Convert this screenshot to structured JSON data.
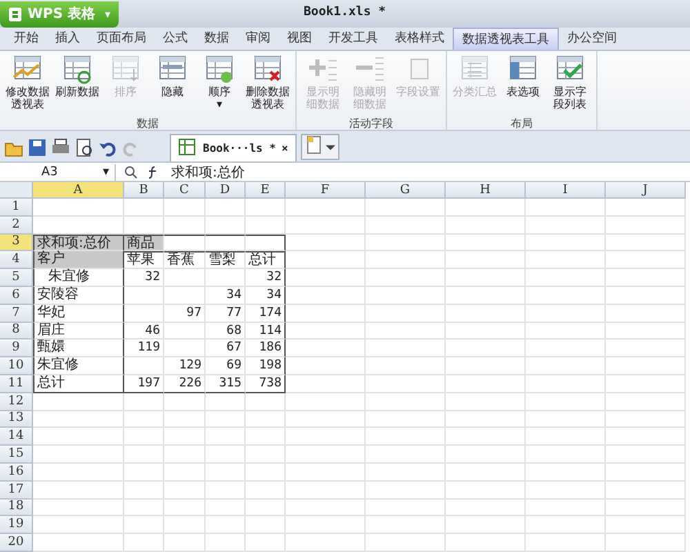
{
  "app_button": {
    "label": "WPS 表格",
    "caret": "▾"
  },
  "window": {
    "title": "Book1.xls *"
  },
  "tabs": [
    {
      "label": "开始",
      "selected": false
    },
    {
      "label": "插入",
      "selected": false
    },
    {
      "label": "页面布局",
      "selected": false
    },
    {
      "label": "公式",
      "selected": false
    },
    {
      "label": "数据",
      "selected": false
    },
    {
      "label": "审阅",
      "selected": false
    },
    {
      "label": "视图",
      "selected": false
    },
    {
      "label": "开发工具",
      "selected": false
    },
    {
      "label": "表格样式",
      "selected": false
    },
    {
      "label": "数据透视表工具",
      "selected": true
    },
    {
      "label": "办公空间",
      "selected": false
    }
  ],
  "ribbon_groups": [
    {
      "title": "数据",
      "buttons": [
        {
          "lines": [
            "修改数据",
            "透视表"
          ],
          "disabled": false
        },
        {
          "lines": [
            "刷新数据"
          ],
          "disabled": false
        },
        {
          "lines": [
            "排序"
          ],
          "disabled": true
        },
        {
          "lines": [
            "隐藏"
          ],
          "disabled": false
        },
        {
          "lines": [
            "顺序"
          ],
          "disabled": false,
          "caret": "▾"
        },
        {
          "lines": [
            "删除数据",
            "透视表"
          ],
          "disabled": false
        }
      ]
    },
    {
      "title": "活动字段",
      "buttons": [
        {
          "lines": [
            "显示明",
            "细数据"
          ],
          "disabled": true
        },
        {
          "lines": [
            "隐藏明",
            "细数据"
          ],
          "disabled": true
        },
        {
          "lines": [
            "字段设置"
          ],
          "disabled": true
        }
      ]
    },
    {
      "title": "布局",
      "buttons": [
        {
          "lines": [
            "分类汇总"
          ],
          "disabled": true
        },
        {
          "lines": [
            "表选项"
          ],
          "disabled": false
        },
        {
          "lines": [
            "显示字",
            "段列表"
          ],
          "disabled": false
        }
      ]
    }
  ],
  "doc_tab": {
    "title": "Book···ls *",
    "close": "×"
  },
  "formula_bar": {
    "name_box": "A3",
    "name_caret": "▾",
    "formula": "求和项:总价"
  },
  "columns": [
    {
      "label": "A",
      "selected": true
    },
    {
      "label": "B",
      "selected": false
    },
    {
      "label": "C",
      "selected": false
    },
    {
      "label": "D",
      "selected": false
    },
    {
      "label": "E",
      "selected": false
    },
    {
      "label": "F",
      "selected": false
    },
    {
      "label": "G",
      "selected": false
    },
    {
      "label": "H",
      "selected": false
    },
    {
      "label": "I",
      "selected": false
    },
    {
      "label": "J",
      "selected": false
    }
  ],
  "rows": [
    {
      "label": "1",
      "selected": false,
      "cells": []
    },
    {
      "label": "2",
      "selected": false,
      "cells": []
    },
    {
      "label": "3",
      "selected": true,
      "cells": [
        {
          "text": "求和项:总价",
          "shaded": true
        },
        {
          "text": "商品",
          "shaded": true
        }
      ]
    },
    {
      "label": "4",
      "selected": false,
      "cells": [
        {
          "text": "客户",
          "shaded": true
        },
        {
          "text": "苹果"
        },
        {
          "text": "香蕉"
        },
        {
          "text": "雪梨"
        },
        {
          "text": "总计"
        }
      ]
    },
    {
      "label": "5",
      "selected": false,
      "cells": [
        {
          "text": "朱宜修",
          "indented": true
        },
        {
          "text": "32",
          "kind": "number"
        },
        {
          "text": ""
        },
        {
          "text": ""
        },
        {
          "text": "32",
          "kind": "number"
        }
      ]
    },
    {
      "label": "6",
      "selected": false,
      "cells": [
        {
          "text": "安陵容"
        },
        {
          "text": ""
        },
        {
          "text": ""
        },
        {
          "text": "34",
          "kind": "number"
        },
        {
          "text": "34",
          "kind": "number"
        }
      ]
    },
    {
      "label": "7",
      "selected": false,
      "cells": [
        {
          "text": "华妃"
        },
        {
          "text": ""
        },
        {
          "text": "97",
          "kind": "number"
        },
        {
          "text": "77",
          "kind": "number"
        },
        {
          "text": "174",
          "kind": "number"
        }
      ]
    },
    {
      "label": "8",
      "selected": false,
      "cells": [
        {
          "text": "眉庄"
        },
        {
          "text": "46",
          "kind": "number"
        },
        {
          "text": ""
        },
        {
          "text": "68",
          "kind": "number"
        },
        {
          "text": "114",
          "kind": "number"
        }
      ]
    },
    {
      "label": "9",
      "selected": false,
      "cells": [
        {
          "text": "甄嬛"
        },
        {
          "text": "119",
          "kind": "number"
        },
        {
          "text": ""
        },
        {
          "text": "67",
          "kind": "number"
        },
        {
          "text": "186",
          "kind": "number"
        }
      ]
    },
    {
      "label": "10",
      "selected": false,
      "cells": [
        {
          "text": "朱宜修"
        },
        {
          "text": ""
        },
        {
          "text": "129",
          "kind": "number"
        },
        {
          "text": "69",
          "kind": "number"
        },
        {
          "text": "198",
          "kind": "number"
        }
      ]
    },
    {
      "label": "11",
      "selected": false,
      "cells": [
        {
          "text": "总计"
        },
        {
          "text": "197",
          "kind": "number"
        },
        {
          "text": "226",
          "kind": "number"
        },
        {
          "text": "315",
          "kind": "number"
        },
        {
          "text": "738",
          "kind": "number"
        }
      ]
    },
    {
      "label": "12",
      "selected": false,
      "cells": []
    },
    {
      "label": "13",
      "selected": false,
      "cells": []
    },
    {
      "label": "14",
      "selected": false,
      "cells": []
    },
    {
      "label": "15",
      "selected": false,
      "cells": []
    },
    {
      "label": "16",
      "selected": false,
      "cells": []
    },
    {
      "label": "17",
      "selected": false,
      "cells": []
    },
    {
      "label": "18",
      "selected": false,
      "cells": []
    },
    {
      "label": "19",
      "selected": false,
      "cells": []
    },
    {
      "label": "20",
      "selected": false,
      "cells": []
    }
  ]
}
